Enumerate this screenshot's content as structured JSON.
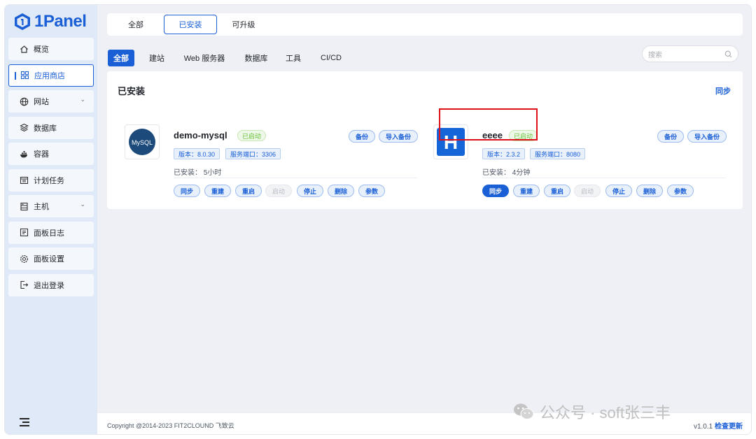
{
  "app": {
    "logo_text": "1Panel"
  },
  "sidebar": {
    "items": [
      {
        "label": "概览",
        "icon": "home-icon"
      },
      {
        "label": "应用商店",
        "icon": "grid-icon",
        "active": true
      },
      {
        "label": "网站",
        "icon": "globe-icon",
        "expandable": true
      },
      {
        "label": "数据库",
        "icon": "layers-icon"
      },
      {
        "label": "容器",
        "icon": "docker-icon"
      },
      {
        "label": "计划任务",
        "icon": "calendar-icon"
      },
      {
        "label": "主机",
        "icon": "server-icon",
        "expandable": true
      },
      {
        "label": "面板日志",
        "icon": "log-icon"
      },
      {
        "label": "面板设置",
        "icon": "gear-icon"
      },
      {
        "label": "退出登录",
        "icon": "logout-icon"
      }
    ]
  },
  "top_tabs": [
    {
      "label": "全部"
    },
    {
      "label": "已安装",
      "active": true
    },
    {
      "label": "可升级"
    }
  ],
  "categories": [
    {
      "label": "全部",
      "active": true
    },
    {
      "label": "建站"
    },
    {
      "label": "Web 服务器"
    },
    {
      "label": "数据库"
    },
    {
      "label": "工具"
    },
    {
      "label": "CI/CD"
    }
  ],
  "search": {
    "placeholder": "搜索"
  },
  "panel": {
    "title": "已安装",
    "sync_link": "同步"
  },
  "apps": [
    {
      "name": "demo-mysql",
      "icon_text": "MySQL",
      "status": "已启动",
      "version_tag": "版本：8.0.30",
      "port_tag": "服务端口：3306",
      "installed_time": "已安装：  5小时",
      "top_buttons": [
        "备份",
        "导入备份"
      ],
      "actions": [
        "同步",
        "重建",
        "重启",
        "启动",
        "停止",
        "删除",
        "参数"
      ]
    },
    {
      "name": "eeee",
      "icon_text": "H",
      "status": "已启动",
      "version_tag": "版本：2.3.2",
      "port_tag": "服务端口：8080",
      "installed_time": "已安装：  4分钟",
      "top_buttons": [
        "备份",
        "导入备份"
      ],
      "actions": [
        "同步",
        "重建",
        "重启",
        "启动",
        "停止",
        "删除",
        "参数"
      ]
    }
  ],
  "footer": {
    "copyright": "Copyright @2014-2023 FIT2CLOUND 飞致云",
    "version": "v1.0.1",
    "check_update": "检查更新"
  },
  "watermark": {
    "text": "公众号 · soft张三丰"
  },
  "colors": {
    "accent": "#1a5fd6",
    "success": "#67c23a",
    "highlight": "#e0101a"
  }
}
